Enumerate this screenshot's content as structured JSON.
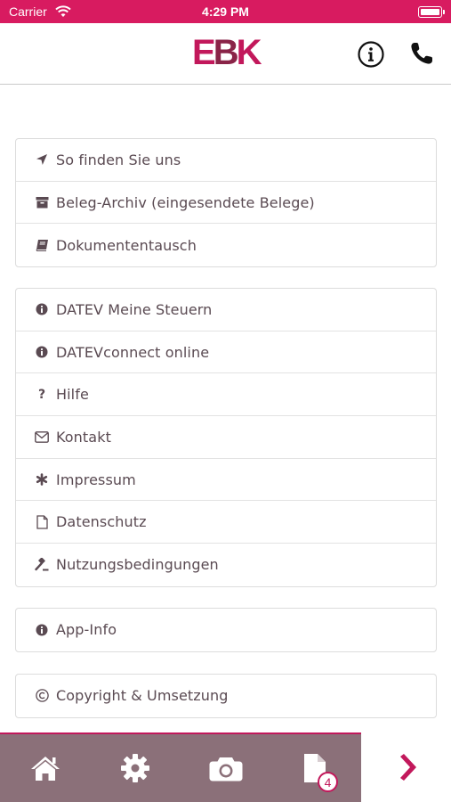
{
  "status_bar": {
    "carrier": "Carrier",
    "time": "4:29 PM"
  },
  "header": {
    "logo_part1": "E",
    "logo_part2": "B",
    "logo_part3": "K"
  },
  "menu_groups": [
    {
      "items": [
        {
          "label": "So finden Sie uns",
          "icon": "location-arrow-icon"
        },
        {
          "label": "Beleg-Archiv (eingesendete Belege)",
          "icon": "archive-icon"
        },
        {
          "label": "Dokumententausch",
          "icon": "book-icon"
        }
      ]
    },
    {
      "items": [
        {
          "label": "DATEV Meine Steuern",
          "icon": "info-circle-icon"
        },
        {
          "label": "DATEVconnect online",
          "icon": "info-circle-icon"
        },
        {
          "label": "Hilfe",
          "icon": "question-icon"
        },
        {
          "label": "Kontakt",
          "icon": "envelope-icon"
        },
        {
          "label": "Impressum",
          "icon": "asterisk-icon"
        },
        {
          "label": "Datenschutz",
          "icon": "file-icon"
        },
        {
          "label": "Nutzungsbedingungen",
          "icon": "gavel-icon"
        }
      ]
    },
    {
      "items": [
        {
          "label": "App-Info",
          "icon": "info-circle-icon"
        }
      ]
    },
    {
      "items": [
        {
          "label": "Copyright & Umsetzung",
          "icon": "copyright-icon"
        }
      ]
    }
  ],
  "tab_bar": {
    "documents_badge": "4",
    "tabs": [
      "home-icon",
      "settings-gear-icon",
      "camera-icon",
      "documents-icon",
      "chevron-right-icon"
    ]
  },
  "colors": {
    "accent": "#c2185b",
    "status_bar": "#d81b60",
    "tab_bar": "#8b7079",
    "text": "#5a4a52"
  }
}
